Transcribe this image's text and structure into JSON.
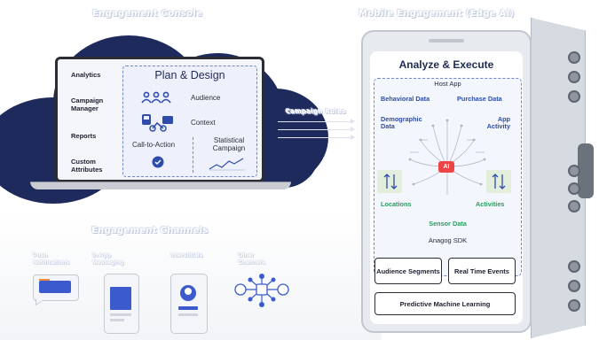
{
  "headings": {
    "console": "Engagement Console",
    "mobile": "Mobile Engagement (Edge AI)",
    "channels": "Engagement Channels"
  },
  "console": {
    "menu": [
      "Analytics",
      "Campaign Manager",
      "Reports",
      "Custom Attributes"
    ],
    "plan_title": "Plan & Design",
    "audience": "Audience",
    "context": "Context",
    "call_to_action": "Call-to-Action",
    "statistical_campaign": "Statistical Campaign"
  },
  "arrow_label": "Campaign Rules",
  "mobile": {
    "title": "Analyze & Execute",
    "host_app": "Host App",
    "behavioral": "Behavioral Data",
    "purchase": "Purchase Data",
    "demographic": "Demographic Data",
    "app_activity": "App Activity",
    "ai": "AI",
    "locations": "Locations",
    "activities": "Activities",
    "sensor": "Sensor Data",
    "sdk": "Anagog SDK",
    "btn_audience": "Audience Segments",
    "btn_realtime": "Real Time Events",
    "btn_pml": "Predictive Machine Learning"
  },
  "channels": {
    "push": "Push Notifications",
    "inapp": "In App Messaging",
    "interstitial": "Interstitials",
    "other": "Other Channels"
  },
  "colors": {
    "cloud": "#1f2a5c",
    "accent_blue": "#2d4cab",
    "accent_green": "#2a9d5c",
    "ai_red": "#ef4444"
  }
}
